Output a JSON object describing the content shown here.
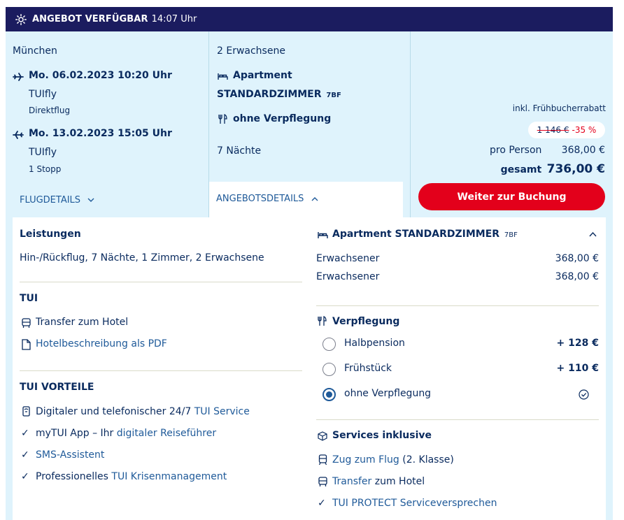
{
  "banner": {
    "title": "ANGEBOT VERFÜGBAR",
    "time": "14:07 Uhr"
  },
  "flights": {
    "departure_airport": "München",
    "outbound": {
      "date": "Mo. 06.02.2023 10:20 Uhr",
      "carrier": "TUIfly",
      "stops": "Direktflug"
    },
    "return": {
      "date": "Mo. 13.02.2023 15:05 Uhr",
      "carrier": "TUIfly",
      "stops": "1 Stopp"
    },
    "details_link": "FLUGDETAILS"
  },
  "offer": {
    "travellers": "2 Erwachsene",
    "room_type": "Apartment",
    "room_name": "STANDARDZIMMER",
    "room_code": "7BF",
    "board": "ohne Verpflegung",
    "nights": "7 Nächte",
    "details_tab": "ANGEBOTSDETAILS"
  },
  "price": {
    "discount_note": "inkl. Frühbucherrabatt",
    "old_price": "1 146 €",
    "discount": "-35 %",
    "per_person_label": "pro Person",
    "per_person_value": "368,00 €",
    "total_label": "gesamt",
    "total_value": "736,00 €",
    "book_button": "Weiter zur Buchung"
  },
  "details": {
    "services_title": "Leistungen",
    "services_text": "Hin-/Rückflug, 7 Nächte, 1 Zimmer, 2 Erwachsene",
    "tui_title": "TUI",
    "tui_items": [
      {
        "label": "Transfer zum Hotel",
        "icon": "bus-icon"
      },
      {
        "label": "Hotelbeschreibung als PDF",
        "icon": "document-icon"
      }
    ],
    "advantages_title": "TUI VORTEILE",
    "advantages": [
      {
        "text": "Digitaler und telefonischer 24/7 ",
        "link": "TUI Service",
        "icon": "phone-service-icon"
      },
      {
        "text": "myTUI App – Ihr ",
        "link": "digitaler Reiseführer",
        "icon": "check-icon"
      },
      {
        "text": "",
        "link": "SMS-Assistent",
        "icon": "check-icon"
      },
      {
        "text": "Professionelles ",
        "link": "TUI Krisenmanagement",
        "icon": "check-icon"
      }
    ]
  },
  "room": {
    "title": "Apartment STANDARDZIMMER",
    "code": "7BF",
    "rows": [
      {
        "label": "Erwachsener",
        "value": "368,00 €"
      },
      {
        "label": "Erwachsener",
        "value": "368,00 €"
      }
    ]
  },
  "meals": {
    "title": "Verpflegung",
    "options": [
      {
        "label": "Halbpension",
        "price": "+ 128 €",
        "selected": false
      },
      {
        "label": "Frühstück",
        "price": "+ 110 €",
        "selected": false
      },
      {
        "label": "ohne Verpflegung",
        "price": "",
        "selected": true
      }
    ]
  },
  "included": {
    "title": "Services inklusive",
    "items": [
      {
        "link": "Zug zum Flug",
        "text": " (2. Klasse)",
        "icon": "train-icon"
      },
      {
        "link": "Transfer",
        "text": " zum Hotel",
        "icon": "bus-icon"
      },
      {
        "link": "TUI PROTECT Serviceversprechen",
        "text": "",
        "icon": "check-icon"
      }
    ]
  },
  "colors": {
    "navy": "#1b1c5f",
    "text": "#092a5e",
    "link": "#1f5a99",
    "accent_red": "#e3001b",
    "panel_bg": "#dff3fc"
  }
}
